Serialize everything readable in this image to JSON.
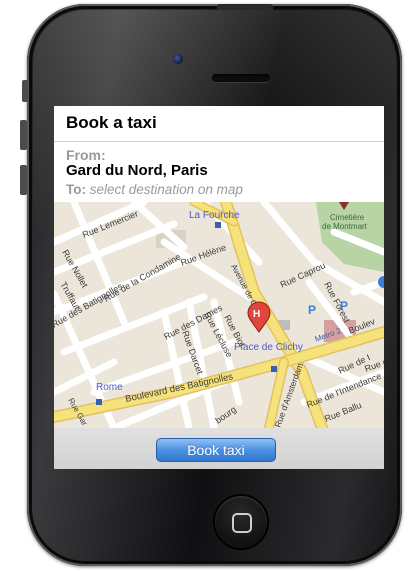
{
  "app": {
    "title": "Book a taxi",
    "from_label": "From:",
    "from_value": "Gard du Nord, Paris",
    "to_label": "To:",
    "to_placeholder": "select destination on map",
    "book_button_label": "Book taxi"
  },
  "map": {
    "pin_letter": "H",
    "labels": {
      "la_fourche": "La Fourche",
      "cimetiere": "Cimetière",
      "de_montmart": "de Montmart",
      "rue_lemercier": "Rue Lemercier",
      "rue_nollet": "Rue Nollet",
      "truffaut": "Truffaut",
      "rue_de_la_condamine": "Rue de la Condamine",
      "rue_des_batignolles": "Rue des Batignolles",
      "rue_helene": "Rue Hélène",
      "rue_des_dames": "Rue des Dames",
      "rue_lecluse": "Rue Lécluse",
      "rue_darcet": "Rue Darcet",
      "rue_biot": "Rue Biot",
      "avenue_de_clichy": "Avenue de Clichy",
      "rue_caprou": "Rue Caprou",
      "rue_forest": "Rue Forest",
      "place_de_clichy": "Place de Clichy",
      "rome": "Rome",
      "boulevard_des_batignolles": "Boulevard des Batignolles",
      "boulevard": "Boulev",
      "rue_de_i": "Rue de I",
      "rue_de_lintendance": "Rue de l'Intendance",
      "rue_ballu": "Rue Ballu",
      "rue_d_amsterdam": "Rue d'Amsterdam",
      "bourg": "bourg",
      "metro": "Metro 2",
      "rue_de": "Rue de",
      "parking": "P",
      "rue_gar": "Rue Gar"
    }
  }
}
